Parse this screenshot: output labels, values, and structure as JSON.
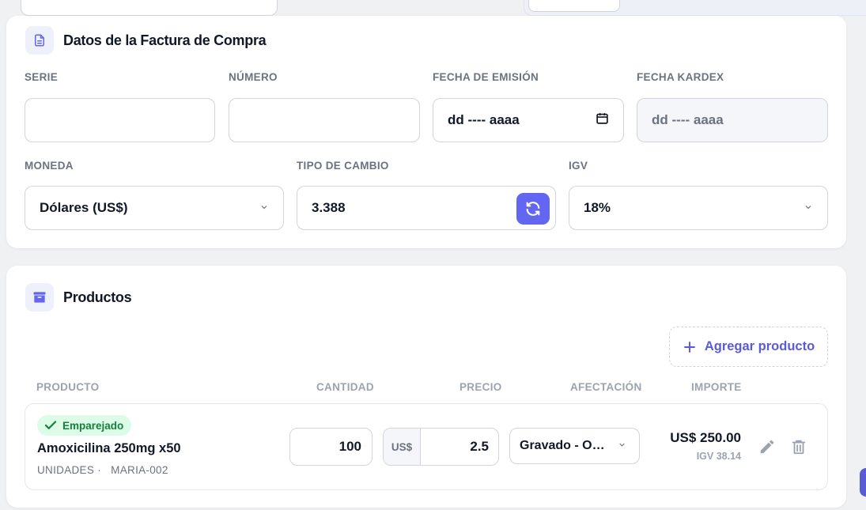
{
  "invoice": {
    "title": "Datos de la Factura de Compra",
    "serie": {
      "label": "SERIE",
      "value": ""
    },
    "numero": {
      "label": "NÚMERO",
      "value": ""
    },
    "fecha_emision": {
      "label": "FECHA DE EMISIÓN",
      "value": "dd ---- aaaa"
    },
    "fecha_kardex": {
      "label": "FECHA KARDEX",
      "value": "dd ---- aaaa"
    },
    "moneda": {
      "label": "MONEDA",
      "value": "Dólares (US$)"
    },
    "tipo_cambio": {
      "label": "TIPO DE CAMBIO",
      "value": "3.388"
    },
    "igv": {
      "label": "IGV",
      "value": "18%"
    }
  },
  "products": {
    "title": "Productos",
    "add_label": "Agregar producto",
    "columns": [
      "PRODUCTO",
      "CANTIDAD",
      "PRECIO",
      "AFECTACIÓN",
      "IMPORTE"
    ],
    "rows": [
      {
        "badge": "Emparejado",
        "name": "Amoxicilina 250mg x50",
        "unit": "UNIDADES ·",
        "code": "MARIA-002",
        "quantity": "100",
        "currency": "US$",
        "price": "2.5",
        "afectacion": "Gravado - Operación Onerosa",
        "importe": "US$ 250.00",
        "igv": "IGV 38.14"
      }
    ]
  },
  "colors": {
    "accent": "#6366f1",
    "badge_bg": "#dcfce7",
    "badge_text": "#15803d"
  },
  "icons": [
    "document-icon",
    "calendar-icon",
    "chevron-down-icon",
    "refresh-icon",
    "archive-box-icon",
    "plus-icon",
    "check-icon",
    "pencil-icon",
    "trash-icon"
  ]
}
